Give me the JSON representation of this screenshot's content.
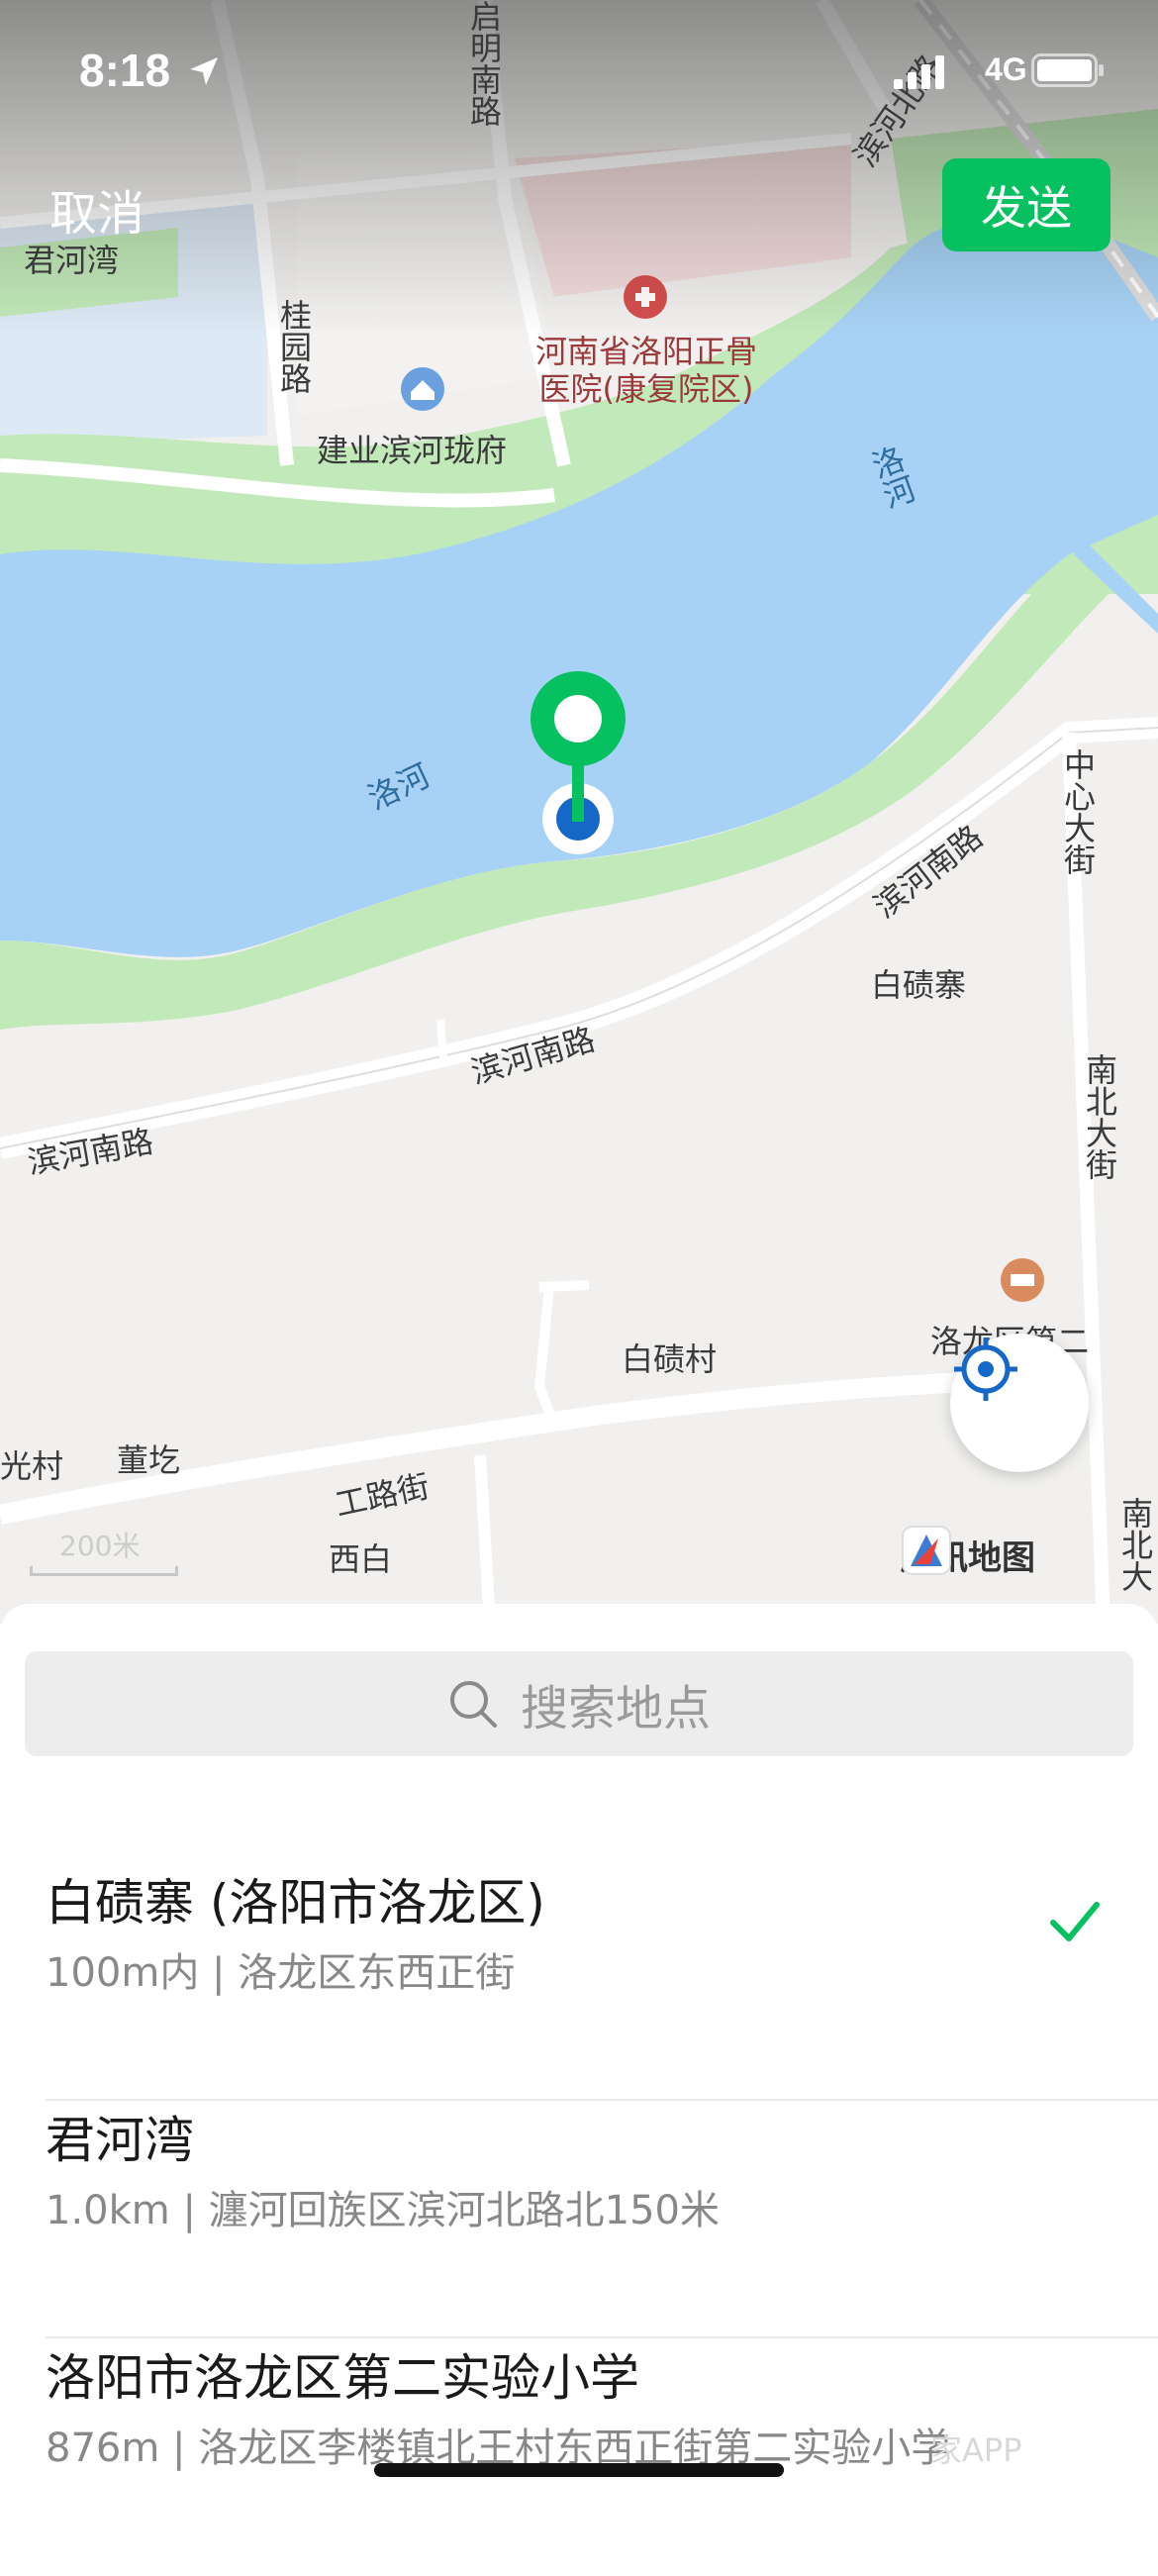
{
  "status_bar": {
    "time": "8:18",
    "network": "4G"
  },
  "header": {
    "cancel_label": "取消",
    "send_label": "发送"
  },
  "map": {
    "labels": {
      "junhewan": "君河湾",
      "qiming_road": "启明南路",
      "binhebei_road": "滨河北路",
      "guiyuan_road": "桂园路",
      "hospital": "河南省洛阳正骨医院(康复院区)",
      "jianye": "建业滨河珑府",
      "luohe_1": "洛河",
      "luohe_2": "洛河",
      "zhongxin_street": "中心大街",
      "binhenan_1": "滨河南路",
      "binhenan_2": "滨河南路",
      "binhenan_3": "滨河南路",
      "baijizhai": "白碛寨",
      "nanbei_street": "南北大街",
      "school": "洛龙区第二",
      "baijicun": "白碛村",
      "guangcun": "光村",
      "dongkeng": "董圪",
      "gonglu_street": "工路街",
      "xibai": "西白",
      "nanbei_street_2": "南北大"
    },
    "scale_label": "200米",
    "provider": "腾讯地图",
    "colors": {
      "water": "#a8d2f5",
      "park": "#c2e9b9",
      "land": "#f1f0ee",
      "pin": "#07c160",
      "dot": "#1668c8"
    }
  },
  "search": {
    "placeholder": "搜索地点"
  },
  "results": [
    {
      "title": "白碛寨 (洛阳市洛龙区)",
      "subtitle": "100m内 | 洛龙区东西正街",
      "selected": true
    },
    {
      "title": "君河湾",
      "subtitle": "1.0km | 瀍河回族区滨河北路北150米",
      "selected": false
    },
    {
      "title": "洛阳市洛龙区第二实验小学",
      "subtitle": "876m | 洛龙区李楼镇北王村东西正街第二实验小学",
      "selected": false
    }
  ],
  "watermark": "家APP"
}
